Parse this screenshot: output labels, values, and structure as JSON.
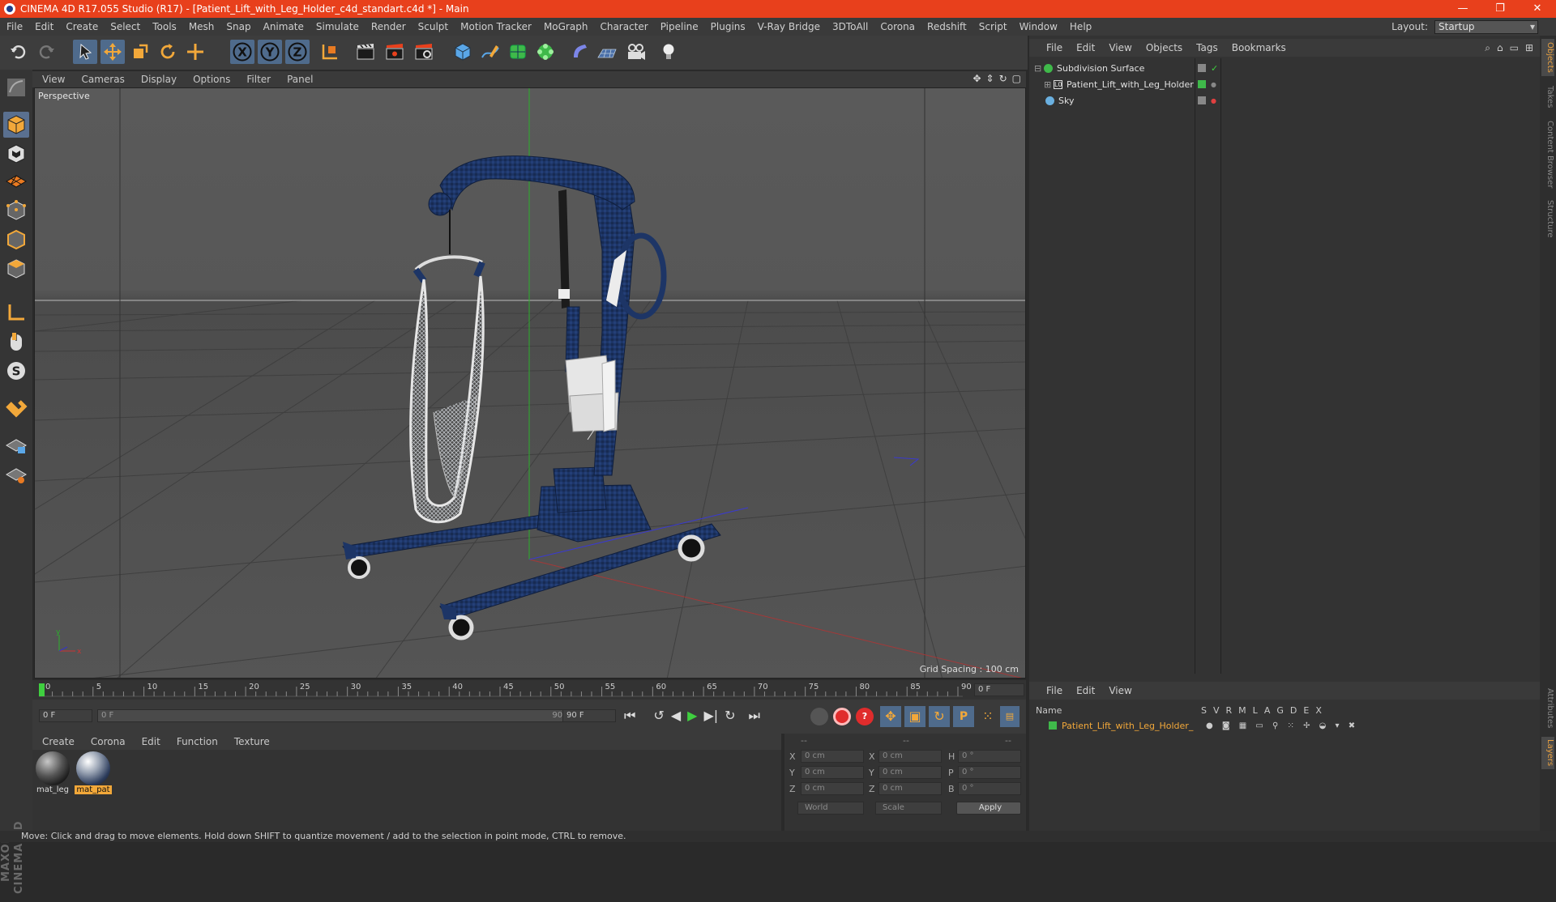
{
  "app": {
    "title": "CINEMA 4D R17.055 Studio (R17) - [Patient_Lift_with_Leg_Holder_c4d_standart.c4d *] - Main",
    "window_buttons": [
      "—",
      "❐",
      "✕"
    ]
  },
  "menubar": {
    "items": [
      "File",
      "Edit",
      "Create",
      "Select",
      "Tools",
      "Mesh",
      "Snap",
      "Animate",
      "Simulate",
      "Render",
      "Sculpt",
      "Motion Tracker",
      "MoGraph",
      "Character",
      "Pipeline",
      "Plugins",
      "V-Ray Bridge",
      "3DToAll",
      "Corona",
      "Redshift",
      "Script",
      "Window",
      "Help"
    ],
    "layout_label": "Layout:",
    "layout_value": "Startup"
  },
  "toolbar": {
    "axis_x": "X",
    "axis_y": "Y",
    "axis_z": "Z"
  },
  "viewport": {
    "menu": [
      "View",
      "Cameras",
      "Display",
      "Options",
      "Filter",
      "Panel"
    ],
    "camera": "Perspective",
    "grid_spacing": "Grid Spacing : 100 cm"
  },
  "timeline": {
    "ticks": [
      "0",
      "5",
      "10",
      "15",
      "20",
      "25",
      "30",
      "35",
      "40",
      "45",
      "50",
      "55",
      "60",
      "65",
      "70",
      "75",
      "80",
      "85",
      "90"
    ],
    "current_frame": "0 F",
    "start_field": "0 F",
    "range_start": "0 F",
    "range_end": "90 F",
    "end_field": "90 F"
  },
  "materials": {
    "menu": [
      "Create",
      "Corona",
      "Edit",
      "Function",
      "Texture"
    ],
    "items": [
      {
        "name": "mat_leg",
        "selected": false
      },
      {
        "name": "mat_pat",
        "selected": true
      }
    ]
  },
  "coordinates": {
    "header": [
      "--",
      "--",
      "--"
    ],
    "rows": [
      {
        "a_label": "X",
        "a_value": "0 cm",
        "b_label": "X",
        "b_value": "0 cm",
        "c_label": "H",
        "c_value": "0 °"
      },
      {
        "a_label": "Y",
        "a_value": "0 cm",
        "b_label": "Y",
        "b_value": "0 cm",
        "c_label": "P",
        "c_value": "0 °"
      },
      {
        "a_label": "Z",
        "a_value": "0 cm",
        "b_label": "Z",
        "b_value": "0 cm",
        "c_label": "B",
        "c_value": "0 °"
      }
    ],
    "world": "World",
    "scale": "Scale",
    "apply": "Apply"
  },
  "objects_panel": {
    "menu": [
      "File",
      "Edit",
      "View",
      "Objects",
      "Tags",
      "Bookmarks"
    ],
    "items": [
      {
        "name": "Subdivision Surface",
        "color": "#3fb94a"
      },
      {
        "name": "Patient_Lift_with_Leg_Holder",
        "color": "#3fb94a"
      },
      {
        "name": "Sky",
        "color": "#888888"
      }
    ]
  },
  "layers_panel": {
    "menu": [
      "File",
      "Edit",
      "View"
    ],
    "name_header": "Name",
    "columns": [
      "S",
      "V",
      "R",
      "M",
      "L",
      "A",
      "G",
      "D",
      "E",
      "X"
    ],
    "item": "Patient_Lift_with_Leg_Holder_"
  },
  "side_tabs": [
    "Objects",
    "Takes",
    "Content Browser",
    "Structure"
  ],
  "side_tabs_bottom": [
    "Attributes",
    "Layers"
  ],
  "brand": "MAXON CINEMA 4D",
  "status": "Move: Click and drag to move elements. Hold down SHIFT to quantize movement / add to the selection in point mode, CTRL to remove.",
  "colors": {
    "titlebar": "#e8401c",
    "accent_selected": "#f2a83a",
    "model_blue": "#1d3566"
  }
}
